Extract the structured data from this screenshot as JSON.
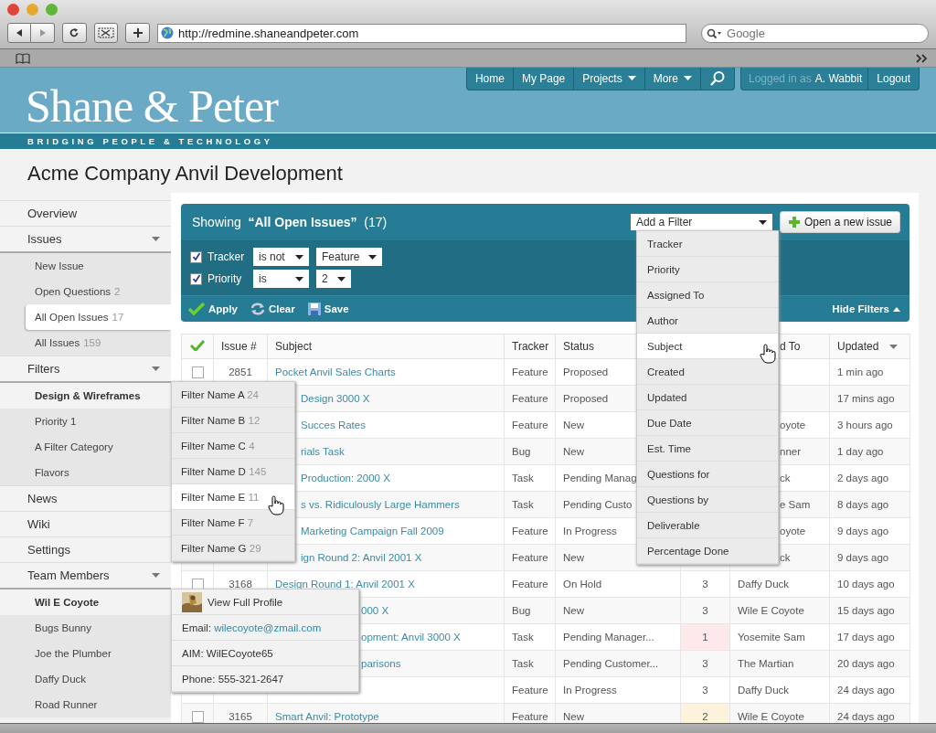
{
  "browser": {
    "url": "http://redmine.shaneandpeter.com",
    "search_placeholder": "Google"
  },
  "site": {
    "logo": "Shane & Peter",
    "tagline": "BRIDGING PEOPLE & TECHNOLOGY",
    "nav": [
      {
        "label": "Home",
        "menu": false
      },
      {
        "label": "My Page",
        "menu": false
      },
      {
        "label": "Projects",
        "menu": true
      },
      {
        "label": "More",
        "menu": true
      }
    ],
    "login_label": "Logged in as",
    "user": "A. Wabbit",
    "logout": "Logout"
  },
  "project_title": "Acme Company Anvil Development",
  "sidebar": [
    {
      "label": "Overview"
    },
    {
      "label": "Issues",
      "expanded": true,
      "children": [
        {
          "label": "New Issue",
          "selected": false,
          "open": false
        },
        {
          "label": "Open Questions",
          "count": "2",
          "selected": false,
          "open": false
        },
        {
          "label": "All Open Issues",
          "count": "17",
          "selected": true,
          "open": false
        },
        {
          "label": "All Issues",
          "count": "159",
          "selected": false,
          "open": false
        }
      ]
    },
    {
      "label": "Filters",
      "expanded": true,
      "children": [
        {
          "label": "Design & Wireframes",
          "selected": false,
          "open": true
        },
        {
          "label": "Priority 1",
          "selected": false,
          "open": false
        },
        {
          "label": "A Filter Category",
          "selected": false,
          "open": false
        },
        {
          "label": "Flavors",
          "selected": false,
          "open": false
        }
      ]
    },
    {
      "label": "News"
    },
    {
      "label": "Wiki"
    },
    {
      "label": "Settings"
    },
    {
      "label": "Team Members",
      "expanded": true,
      "children": [
        {
          "label": "Wil E Coyote",
          "selected": false,
          "open": true
        },
        {
          "label": "Bugs Bunny",
          "selected": false,
          "open": false
        },
        {
          "label": "Joe the Plumber",
          "selected": false,
          "open": false
        },
        {
          "label": "Daffy Duck",
          "selected": false,
          "open": false
        },
        {
          "label": "Road Runner",
          "selected": false,
          "open": false
        }
      ]
    }
  ],
  "query": {
    "heading": "Showing  **“All Open Issues”**  (17)",
    "add_filter": "Add a Filter",
    "new_issue": "Open a new issue",
    "filters": [
      {
        "checked": true,
        "field": "Tracker",
        "operator": "is not",
        "value": "Feature"
      },
      {
        "checked": true,
        "field": "Priority",
        "operator": "is",
        "value": "2"
      }
    ],
    "actions": [
      {
        "kind": "apply",
        "label": "Apply"
      },
      {
        "kind": "clear",
        "label": "Clear"
      },
      {
        "kind": "save",
        "label": "Save"
      }
    ],
    "hide_filters": "Hide Filters"
  },
  "table": {
    "columns": [
      {
        "kind": "check"
      },
      {
        "kind": "text",
        "label": "Issue #"
      },
      {
        "kind": "text",
        "label": "Subject"
      },
      {
        "kind": "text",
        "label": "Tracker"
      },
      {
        "kind": "text",
        "label": "Status"
      },
      {
        "kind": "blank"
      },
      {
        "kind": "text",
        "label": "d To",
        "cut": true
      },
      {
        "kind": "text",
        "label": "Updated",
        "sorted": true
      }
    ],
    "rows": [
      {
        "checked": false,
        "id": "2851",
        "subject": "Pocket Anvil Sales Charts",
        "tracker": "Feature",
        "status": "Proposed",
        "updated": "1 min ago"
      },
      {
        "subject": "Design 3000 X",
        "subject_cut": true,
        "tracker": "Feature",
        "status": "Proposed",
        "updated": "17 mins ago"
      },
      {
        "subject": "Succes Rates",
        "subject_cut": true,
        "tracker": "Feature",
        "status": "New",
        "assigned": "oyote",
        "assigned_cut": true,
        "updated": "3 hours ago"
      },
      {
        "subject": "rials Task",
        "subject_cut": true,
        "tracker": "Bug",
        "status": "New",
        "assigned": "nner",
        "assigned_cut": true,
        "updated": "1 day ago"
      },
      {
        "subject": "Production: 2000 X",
        "subject_cut": true,
        "tracker": "Task",
        "status": "Pending Manag",
        "assigned": "ck",
        "assigned_cut": true,
        "updated": "2 days ago"
      },
      {
        "subject": "s vs. Ridiculously Large Hammers",
        "subject_cut": true,
        "tracker": "Task",
        "status": "Pending Custo",
        "assigned": "e Sam",
        "assigned_cut": true,
        "updated": "8 days ago"
      },
      {
        "subject": "Marketing Campaign Fall 2009",
        "subject_cut": true,
        "tracker": "Feature",
        "status": "In Progress",
        "assigned": "oyote",
        "assigned_cut": true,
        "updated": "9 days ago"
      },
      {
        "subject": "ign Round 2: Anvil 2001 X",
        "subject_cut": true,
        "tracker": "Feature",
        "status": "New",
        "assigned": "ck",
        "assigned_cut": true,
        "updated": "9 days ago"
      },
      {
        "checked": false,
        "id": "3168",
        "subject": "Design Round 1: Anvil 2001 X",
        "tracker": "Feature",
        "status": "On Hold",
        "priority": "3",
        "assigned": "Daffy Duck",
        "updated": "10 days ago"
      },
      {
        "subject": "000 X",
        "subject_cut": true,
        "long_cut": true,
        "tracker": "Bug",
        "status": "New",
        "priority": "3",
        "assigned": "Wile E Coyote",
        "updated": "15 days ago"
      },
      {
        "subject": "opment: Anvil 3000 X",
        "subject_cut": true,
        "long_cut": true,
        "tracker": "Task",
        "status": "Pending Manager...",
        "priority": "1",
        "color": "#fde9e9",
        "assigned": "Yosemite Sam",
        "updated": "17 days ago"
      },
      {
        "subject": "parisons",
        "subject_cut": true,
        "long_cut": true,
        "tracker": "Task",
        "status": "Pending Customer...",
        "priority": "3",
        "assigned": "The Martian",
        "updated": "20 days ago"
      },
      {
        "tracker": "Feature",
        "status": "In Progress",
        "priority": "3",
        "assigned": "Daffy Duck",
        "updated": "24 days ago"
      },
      {
        "checked": false,
        "id": "3165",
        "subject": "Smart Anvil: Prototype",
        "tracker": "Feature",
        "status": "New",
        "priority": "2",
        "color": "#fdf3dc",
        "assigned": "Wile E Coyote",
        "updated": "24 days ago"
      }
    ]
  },
  "filter_popup": [
    {
      "name": "Filter Name A",
      "count": "24",
      "hovered": false
    },
    {
      "name": "Filter Name B",
      "count": "12",
      "hovered": false
    },
    {
      "name": "Filter Name C",
      "count": "4",
      "hovered": false
    },
    {
      "name": "Filter Name D",
      "count": "145",
      "hovered": false
    },
    {
      "name": "Filter Name E",
      "count": "11",
      "hovered": true
    },
    {
      "name": "Filter Name F",
      "count": "7",
      "hovered": false
    },
    {
      "name": "Filter Name G",
      "count": "29",
      "hovered": false
    }
  ],
  "add_filter_menu": [
    {
      "label": "Tracker",
      "hovered": false
    },
    {
      "label": "Priority",
      "hovered": false
    },
    {
      "label": "Assigned To",
      "hovered": false
    },
    {
      "label": "Author",
      "hovered": false
    },
    {
      "label": "Subject",
      "hovered": true
    },
    {
      "label": "Created",
      "hovered": false
    },
    {
      "label": "Updated",
      "hovered": false
    },
    {
      "label": "Due Date",
      "hovered": false
    },
    {
      "label": "Est. Time",
      "hovered": false
    },
    {
      "label": "Questions for",
      "hovered": false
    },
    {
      "label": "Questions by",
      "hovered": false
    },
    {
      "label": "Deliverable",
      "hovered": false
    },
    {
      "label": "Percentage Done",
      "hovered": false
    }
  ],
  "profile_popup": {
    "view_profile": "View Full Profile",
    "email_label": "Email:",
    "email": "wilecoyote@zmail.com",
    "aim": "AIM: WilECoyote65",
    "phone": "Phone: 555-321-2647"
  }
}
